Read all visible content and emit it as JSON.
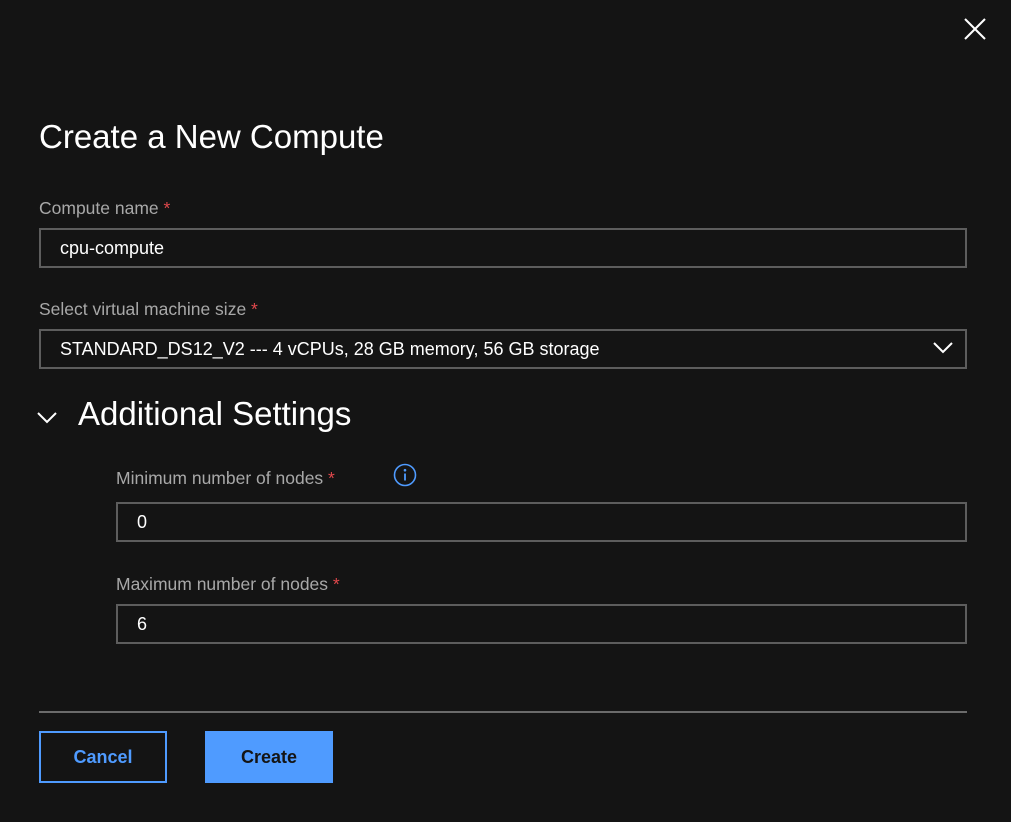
{
  "dialog": {
    "title": "Create a New Compute"
  },
  "compute_name": {
    "label": "Compute name",
    "required_mark": "*",
    "value": "cpu-compute"
  },
  "vm_size": {
    "label": "Select virtual machine size",
    "required_mark": "*",
    "selected": "STANDARD_DS12_V2 --- 4 vCPUs, 28 GB memory, 56 GB storage"
  },
  "additional_settings": {
    "title": "Additional Settings",
    "expanded": true,
    "min_nodes": {
      "label": "Minimum number of nodes",
      "required_mark": "*",
      "value": "0",
      "info_icon": "info-icon"
    },
    "max_nodes": {
      "label": "Maximum number of nodes",
      "required_mark": "*",
      "value": "6"
    }
  },
  "actions": {
    "cancel_label": "Cancel",
    "create_label": "Create"
  },
  "colors": {
    "background": "#141414",
    "accent": "#4f9bff",
    "required": "#e0484c",
    "border": "#5d5d5d",
    "label": "#a8a8a8"
  }
}
